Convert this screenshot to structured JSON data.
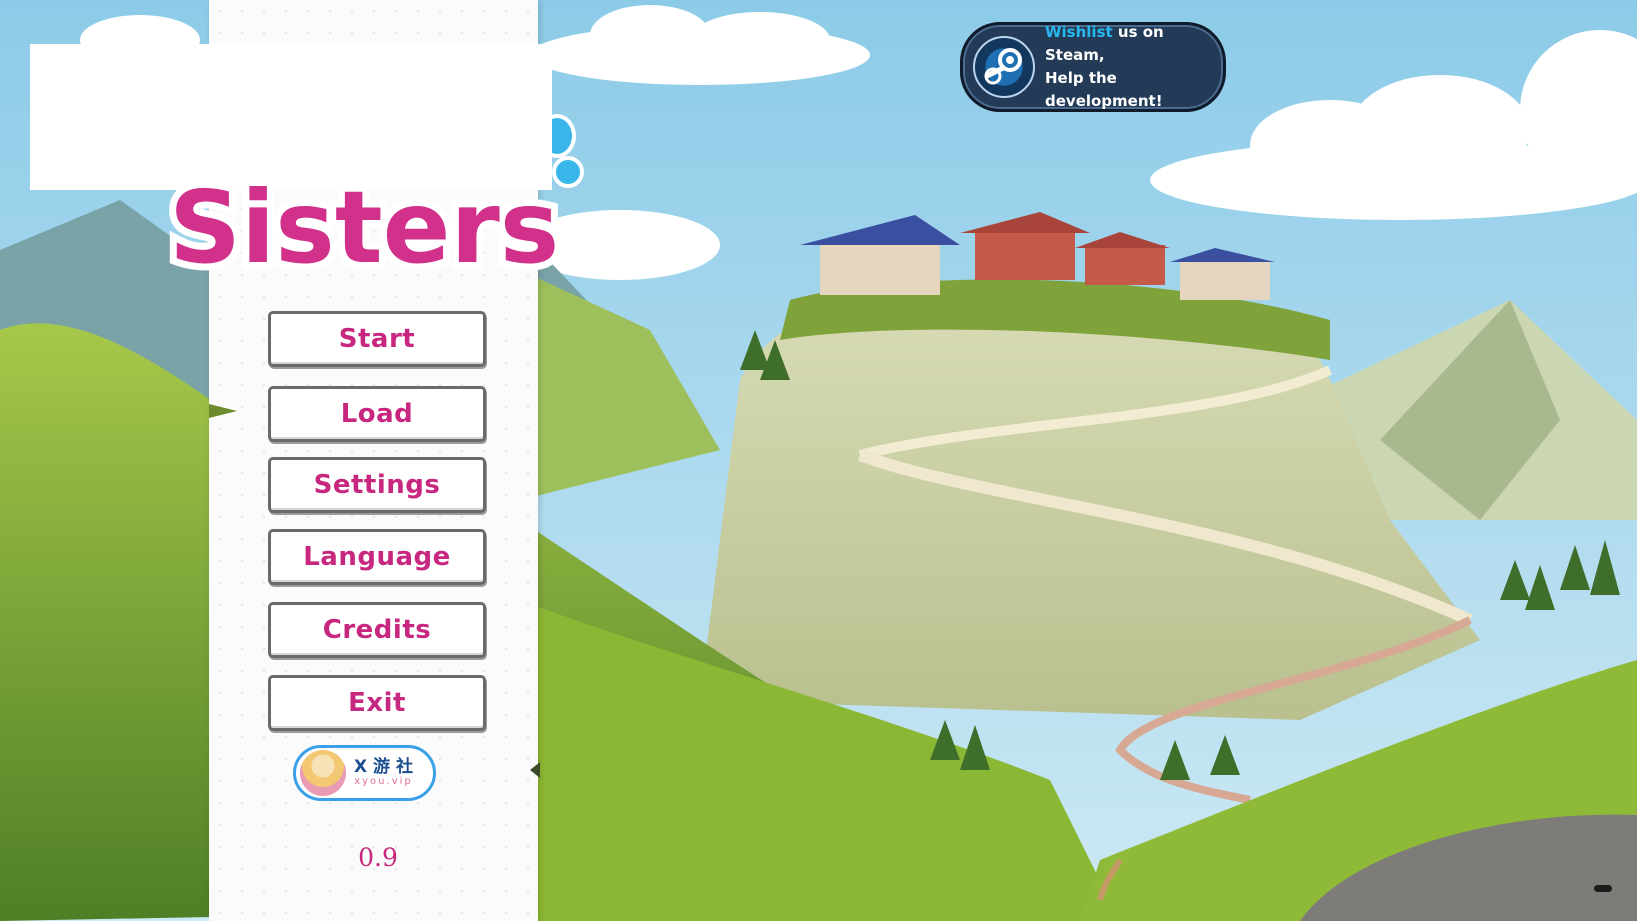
{
  "logo": {
    "title_text": "Sisters",
    "primary_color": "#d1318a",
    "bubble_color": "#38b6ea"
  },
  "menu": {
    "items": [
      {
        "label": "Start"
      },
      {
        "label": "Load"
      },
      {
        "label": "Settings"
      },
      {
        "label": "Language"
      },
      {
        "label": "Credits"
      },
      {
        "label": "Exit"
      }
    ],
    "text_color": "#c8277f"
  },
  "sponsor_badge": {
    "main_text": "X 游 社",
    "sub_text": "xyou.vip"
  },
  "version": "0.9",
  "steam_banner": {
    "highlight": "Wishlist",
    "line1_rest": " us on Steam,",
    "line2": "Help the development!",
    "icon": "steam-icon"
  },
  "colors": {
    "sky": "#9fd3ea",
    "panel": "#fbfbfb",
    "steam_bg": "#243b57"
  }
}
